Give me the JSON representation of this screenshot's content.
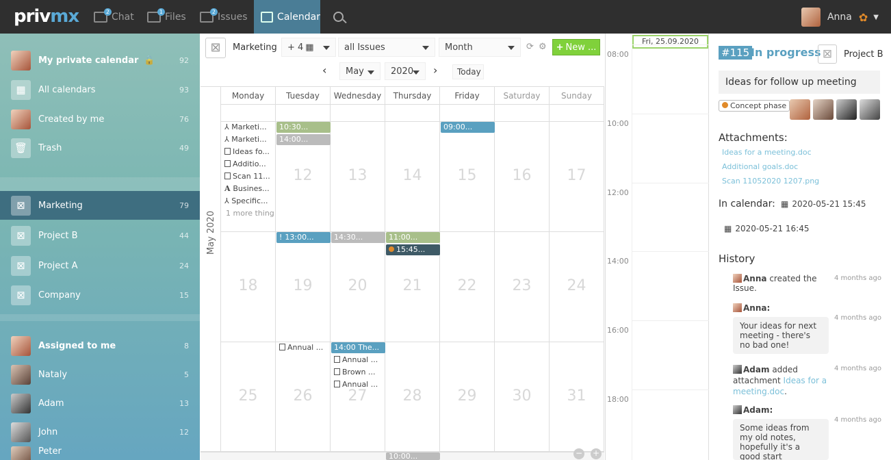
{
  "app": {
    "logo_a": "priv",
    "logo_b": "mx"
  },
  "topnav": [
    {
      "label": "Chat",
      "badge": "2"
    },
    {
      "label": "Files",
      "badge": "1"
    },
    {
      "label": "Issues",
      "badge": "2"
    },
    {
      "label": "Calendar",
      "badge": ""
    }
  ],
  "user": {
    "name": "Anna"
  },
  "sidebar": {
    "personal": [
      {
        "label": "My private calendar",
        "count": "92",
        "bold": true
      },
      {
        "label": "All calendars",
        "count": "93"
      },
      {
        "label": "Created by me",
        "count": "76"
      },
      {
        "label": "Trash",
        "count": "49"
      }
    ],
    "projects": [
      {
        "label": "Marketing",
        "count": "79"
      },
      {
        "label": "Project B",
        "count": "44"
      },
      {
        "label": "Project A",
        "count": "24"
      },
      {
        "label": "Company",
        "count": "15"
      }
    ],
    "people": [
      {
        "label": "Assigned to me",
        "count": "8"
      },
      {
        "label": "Nataly",
        "count": "5"
      },
      {
        "label": "Adam",
        "count": "13"
      },
      {
        "label": "John",
        "count": "12"
      },
      {
        "label": "Peter",
        "count": ""
      }
    ]
  },
  "toolbar": {
    "calendar": "Marketing",
    "extra": "+ 4",
    "filter": "all Issues",
    "view": "Month",
    "new_label": "New ...",
    "month": "May",
    "year": "2020",
    "today": "Today"
  },
  "calendar": {
    "month_label": "May 2020",
    "days": [
      "Monday",
      "Tuesday",
      "Wednesday",
      "Thursday",
      "Friday",
      "Saturday",
      "Sunday"
    ],
    "weeks": [
      [
        "",
        "12",
        "13",
        "14",
        "15",
        "16",
        "17"
      ],
      [
        "18",
        "19",
        "20",
        "21",
        "22",
        "23",
        "24"
      ],
      [
        "25",
        "26",
        "27",
        "28",
        "29",
        "30",
        "31"
      ]
    ],
    "events": {
      "mon11": [
        "Marketi...",
        "Marketi...",
        "Ideas fo...",
        "Additio...",
        "Scan 11...",
        "Busines...",
        "Specific..."
      ],
      "mon11_more": "1 more thing",
      "tue12a": "10:30...",
      "tue12b": "14:00...",
      "fri15": "09:00...",
      "tue19": "13:00...",
      "wed20": "14:30...",
      "thu21a": "11:00...",
      "thu21b": "15:45...",
      "tue26": "Annual ...",
      "wed27a": "14:00 The...",
      "wed27b": "Annual ...",
      "wed27c": "Brown ...",
      "wed27d": "Annual ...",
      "thu_next": "10:00..."
    }
  },
  "dayview": {
    "date": "Fri, 25.09.2020",
    "hours": [
      "08:00",
      "10:00",
      "12:00",
      "14:00",
      "16:00",
      "18:00"
    ]
  },
  "detail": {
    "id": "#115",
    "status": "In progress",
    "project": "Project B",
    "title": "Ideas for follow up meeting",
    "tag": "Concept phase",
    "att_header": "Attachments:",
    "attachments": [
      "Ideas for a meeting.doc",
      "Additional goals.doc",
      "Scan 11052020 1207.png"
    ],
    "incal_header": "In calendar:",
    "incal_1": "2020-05-21 15:45",
    "incal_2": "2020-05-21 16:45",
    "history_header": "History",
    "h1_name": "Anna",
    "h1_text": "created the Issue.",
    "h1_time": "4 months ago",
    "h2_name": "Anna:",
    "h2_time": "4 months ago",
    "h2_msg": "Your ideas for next meeting - there's no bad one!",
    "h3_name": "Adam",
    "h3_text": "added attachment",
    "h3_link": "Ideas for a meeting.doc",
    "h3_time": "4 months ago",
    "h4_name": "Adam:",
    "h4_time": "4 months ago",
    "h4_msg": "Some ideas from my old notes, hopefully it's a good start"
  },
  "colors": {
    "accent": "#5aa9d6",
    "green": "#80d13b",
    "olive": "#a8bf8a",
    "gray": "#bbbbbb",
    "dark": "#3e5a66"
  }
}
